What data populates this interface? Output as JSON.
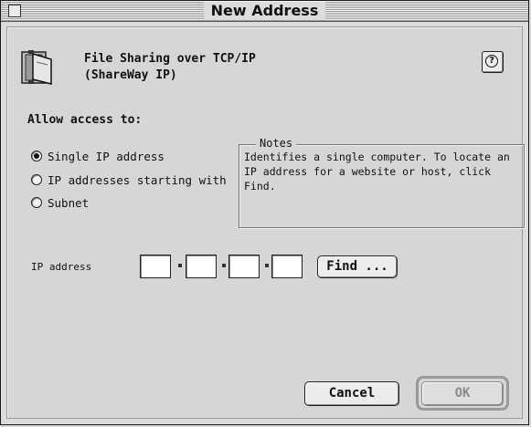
{
  "window": {
    "title": "New Address"
  },
  "header": {
    "line1": "File Sharing over TCP/IP",
    "line2": "(ShareWay IP)",
    "help_label": "?",
    "icon": "file-sharing-folder-icon"
  },
  "access": {
    "label": "Allow access to:",
    "options": [
      {
        "label": "Single IP address",
        "selected": true
      },
      {
        "label": "IP addresses starting with",
        "selected": false
      },
      {
        "label": "Subnet",
        "selected": false
      }
    ]
  },
  "notes": {
    "legend": "Notes",
    "text": "Identifies a single computer.  To locate an IP address for a website or host, click Find."
  },
  "ip": {
    "label": "IP address",
    "octets": [
      "",
      "",
      "",
      ""
    ],
    "find_label": "Find ..."
  },
  "footer": {
    "cancel_label": "Cancel",
    "ok_label": "OK"
  }
}
